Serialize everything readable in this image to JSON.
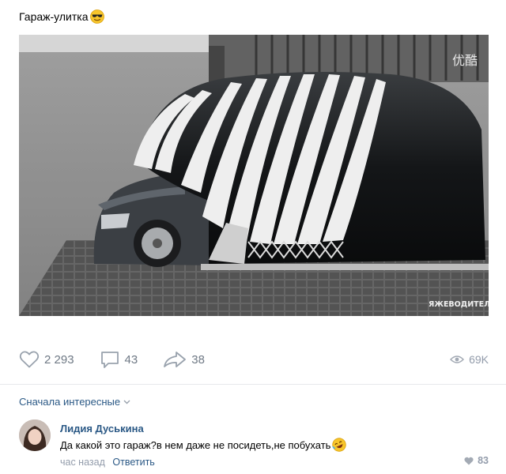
{
  "post": {
    "title": "Гараж-улитка",
    "watermark_top": "优酷",
    "watermark_bottom": "ЯЖЕВОДИТЕЛЬ"
  },
  "actions": {
    "likes": "2 293",
    "comments": "43",
    "shares": "38",
    "views": "69K"
  },
  "comments_section": {
    "sort_label": "Сначала интересные"
  },
  "comment": {
    "author": "Лидия Дуськина",
    "text": "Да какой это гараж?в нем даже не посидеть,не побухать",
    "time": "час назад",
    "reply_label": "Ответить",
    "likes": "83"
  },
  "colors": {
    "link": "#2a5885",
    "muted": "#939cab",
    "divider": "#e7e8ec"
  }
}
